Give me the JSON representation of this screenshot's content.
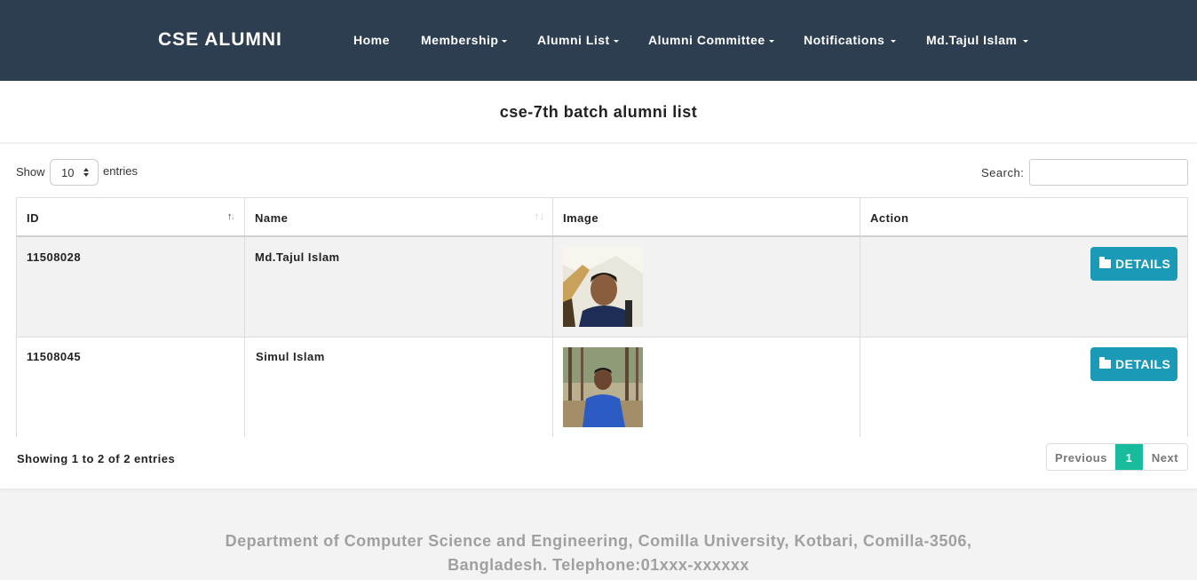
{
  "navbar": {
    "brand": "CSE ALUMNI",
    "items": [
      {
        "label": "Home",
        "dropdown": false
      },
      {
        "label": "Membership",
        "dropdown": true
      },
      {
        "label": "Alumni List",
        "dropdown": true
      },
      {
        "label": "Alumni Committee",
        "dropdown": true
      },
      {
        "label": "Notifications",
        "dropdown": true
      },
      {
        "label": "Md.Tajul Islam",
        "dropdown": true
      }
    ]
  },
  "page": {
    "title": "cse-7th batch alumni list"
  },
  "table_controls": {
    "show_label": "Show",
    "entries_value": "10",
    "entries_label": "entries",
    "search_label": "Search:",
    "search_value": ""
  },
  "table": {
    "columns": [
      "ID",
      "Name",
      "Image",
      "Action"
    ],
    "sort": {
      "column": "ID",
      "direction": "ascending"
    },
    "rows": [
      {
        "id": "11508028",
        "name": "Md.Tajul Islam",
        "image": "alumni-photo",
        "action_label": "DETAILS"
      },
      {
        "id": "11508045",
        "name": "Simul Islam",
        "image": "alumni-photo",
        "action_label": "DETAILS"
      }
    ]
  },
  "table_footer": {
    "info": "Showing 1 to 2 of 2 entries",
    "pagination": {
      "previous": "Previous",
      "current": "1",
      "next": "Next"
    }
  },
  "footer": {
    "line1": "Department of Computer Science and Engineering, Comilla University, Kotbari, Comilla-3506,",
    "line2": "Bangladesh. Telephone:01xxx-xxxxxx"
  },
  "colors": {
    "navbar_bg": "#2c3e50",
    "button_bg": "#1b9ab8",
    "pagination_active": "#18bc9c",
    "striped_row": "#f2f2f2",
    "footer_text": "#a0a0a0"
  },
  "icons": {
    "details": "folder-icon",
    "dropdown": "caret-down-icon",
    "sort": "sort-icon",
    "select": "select-arrows-icon"
  }
}
